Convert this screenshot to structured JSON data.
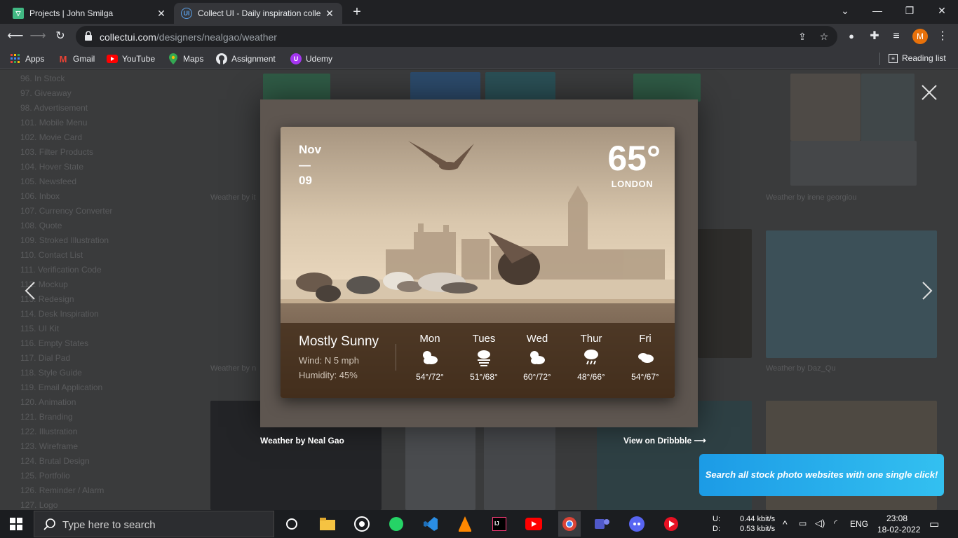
{
  "browser": {
    "tabs": [
      {
        "title": "Projects | John Smilga",
        "active": false
      },
      {
        "title": "Collect UI - Daily inspiration colle",
        "active": true
      }
    ],
    "url_host": "collectui.com",
    "url_path": "/designers/nealgao/weather",
    "profile_initial": "M",
    "bookmarks": [
      "Apps",
      "Gmail",
      "YouTube",
      "Maps",
      "Assignment",
      "Udemy"
    ],
    "reading_list": "Reading list"
  },
  "sidebar": {
    "items": [
      "96. In Stock",
      "97. Giveaway",
      "98. Advertisement",
      "101. Mobile Menu",
      "102. Movie Card",
      "103. Filter Products",
      "104. Hover State",
      "105. Newsfeed",
      "106. Inbox",
      "107. Currency Converter",
      "108. Quote",
      "109. Stroked Illustration",
      "110. Contact List",
      "111. Verification Code",
      "112. Mockup",
      "113. Redesign",
      "114. Desk Inspiration",
      "115. UI Kit",
      "116. Empty States",
      "117. Dial Pad",
      "118. Style Guide",
      "119. Email Application",
      "120. Animation",
      "121. Branding",
      "122. Illustration",
      "123. Wireframe",
      "124. Brutal Design",
      "125. Portfolio",
      "126. Reminder / Alarm",
      "127. Logo"
    ]
  },
  "background_captions": {
    "c1": "Weather by it",
    "c2": "Weather by irene georgiou",
    "c3": "Weather by n",
    "c4": "Weather by Daz_Qu"
  },
  "weather": {
    "month": "Nov",
    "dash": "—",
    "day": "09",
    "temp": "65°",
    "city": "LONDON",
    "condition": "Mostly Sunny",
    "wind": "Wind: N 5 mph",
    "humidity": "Humidity: 45%",
    "forecast": [
      {
        "day": "Mon",
        "icon": "cloud-sun-icon",
        "range": "54°/72°"
      },
      {
        "day": "Tues",
        "icon": "fog-icon",
        "range": "51°/68°"
      },
      {
        "day": "Wed",
        "icon": "cloud-sun-icon",
        "range": "60°/72°"
      },
      {
        "day": "Thur",
        "icon": "rain-icon",
        "range": "48°/66°"
      },
      {
        "day": "Fri",
        "icon": "cloudy-icon",
        "range": "54°/67°"
      }
    ]
  },
  "lightbox": {
    "caption": "Weather by Neal Gao",
    "dribbble_link": "View on Dribbble ⟶"
  },
  "ad": {
    "text": "Search all stock photo websites with one single click!"
  },
  "taskbar": {
    "search_placeholder": "Type here to search",
    "net_up_label": "U:",
    "net_down_label": "D:",
    "net_up": "0.44 kbit/s",
    "net_down": "0.53 kbit/s",
    "lang": "ENG",
    "time": "23:08",
    "date": "18-02-2022"
  }
}
